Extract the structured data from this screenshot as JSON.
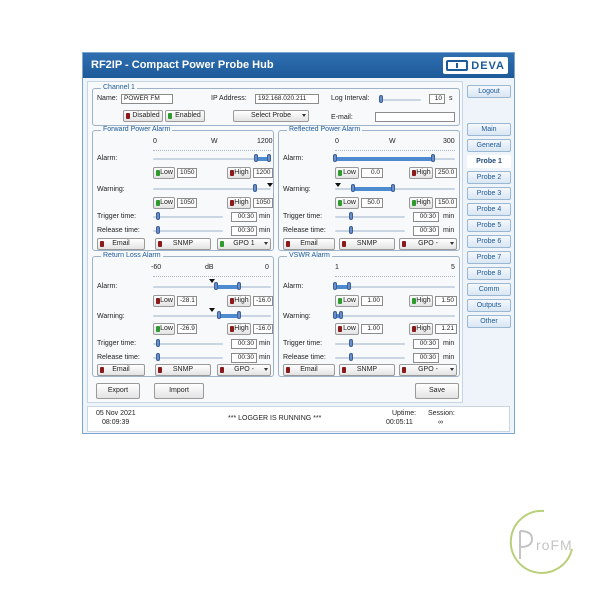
{
  "app": {
    "title": "RF2IP - Compact Power Probe Hub",
    "brand": "DEVA",
    "brand_sub": "BROADCAST"
  },
  "channel": {
    "legend": "Channel 1",
    "name_label": "Name:",
    "name_value": "POWER FM",
    "ip_label": "IP Address:",
    "ip_value": "192.168.020.211",
    "log_label": "Log Interval:",
    "log_value": "10",
    "log_unit": "s",
    "email_label": "E-mail:",
    "email_value": "",
    "disabled_label": "Disabled",
    "enabled_label": "Enabled",
    "select_probe": "Select Probe"
  },
  "labels": {
    "alarm": "Alarm:",
    "warning": "Warning:",
    "trigger": "Trigger time:",
    "release": "Release time:",
    "low": "Low",
    "high": "High",
    "min": "min",
    "email": "Email",
    "snmp": "SNMP"
  },
  "forward": {
    "legend": "Forward Power Alarm",
    "scale_min": "0",
    "unit": "W",
    "scale_max": "1200",
    "alarm_low": "1050",
    "alarm_high": "1200",
    "warn_low": "1050",
    "warn_high": "1050",
    "trigger": "00:30",
    "release": "00:30",
    "gpo": "GPO 1"
  },
  "reflected": {
    "legend": "Reflected Power Alarm",
    "scale_min": "0",
    "unit": "W",
    "scale_max": "300",
    "alarm_low": "0.0",
    "alarm_high": "250.0",
    "warn_low": "50.0",
    "warn_high": "150.0",
    "trigger": "00:30",
    "release": "00:30",
    "gpo": "GPO -"
  },
  "return_loss": {
    "legend": "Return Loss Alarm",
    "scale_min": "-60",
    "unit": "dB",
    "scale_max": "0",
    "alarm_low": "-28.1",
    "alarm_high": "-16.0",
    "warn_low": "-26.9",
    "warn_high": "-16.0",
    "trigger": "00:30",
    "release": "00:30",
    "gpo": "GPO -"
  },
  "vswr": {
    "legend": "VSWR Alarm",
    "scale_min": "1",
    "unit": "",
    "scale_max": "5",
    "alarm_low": "1.00",
    "alarm_high": "1.50",
    "warn_low": "1.00",
    "warn_high": "1.21",
    "trigger": "00:30",
    "release": "00:30",
    "gpo": "GPO -"
  },
  "footer": {
    "export": "Export",
    "import": "Import",
    "save": "Save"
  },
  "status": {
    "date": "05 Nov 2021",
    "time": "08:09:39",
    "message": "*** LOGGER IS RUNNING ***",
    "uptime_label": "Uptime:",
    "uptime_value": "00:05:11",
    "session_label": "Session:",
    "session_value": "∞"
  },
  "nav": {
    "logout": "Logout",
    "items": [
      "Main",
      "General",
      "Probe 1",
      "Probe 2",
      "Probe 3",
      "Probe 4",
      "Probe 5",
      "Probe 6",
      "Probe 7",
      "Probe 8",
      "Comm",
      "Outputs",
      "Other"
    ],
    "active": "Probe 1"
  },
  "watermark": {
    "text": "roFM",
    "prefix": "P"
  },
  "colors": {
    "titlebar": "#1d5a9a",
    "accent": "#4d8bd0",
    "led_red": "#8b1b1b",
    "led_green": "#2f9a2f"
  }
}
